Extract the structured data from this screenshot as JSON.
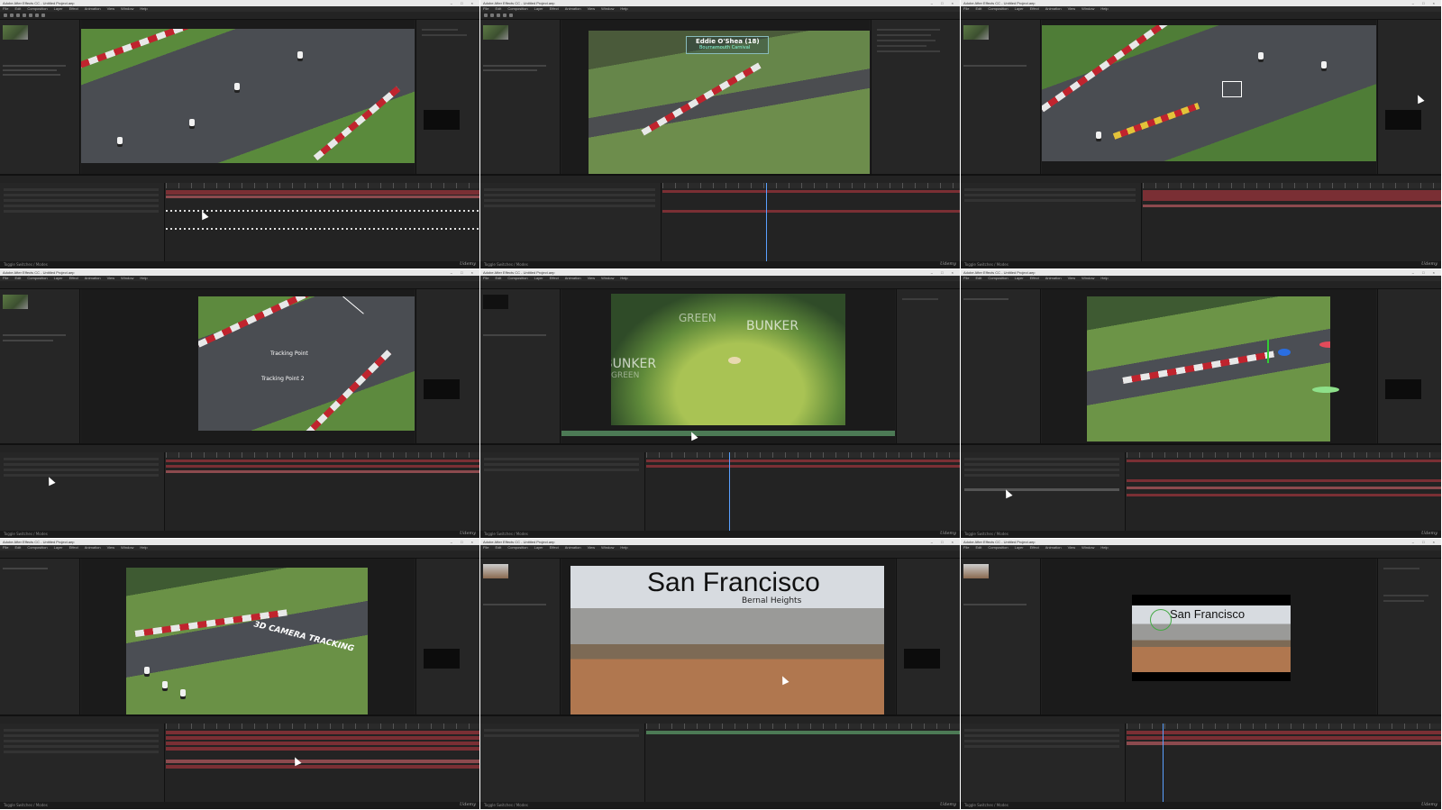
{
  "app": {
    "window_title": "Adobe After Effects CC - Untitled Project.aep",
    "window_controls": "– □ ×",
    "menu": [
      "File",
      "Edit",
      "Composition",
      "Layer",
      "Effect",
      "Animation",
      "View",
      "Window",
      "Help"
    ],
    "status": "Toggle Switches / Modes",
    "watermark": "Udemy"
  },
  "tiles": [
    {
      "id": "1",
      "overlay_texts": []
    },
    {
      "id": "2",
      "overlay_texts": [
        "Eddie O'Shea (18)",
        "Bournemouth Carnival"
      ]
    },
    {
      "id": "3",
      "overlay_texts": []
    },
    {
      "id": "4",
      "overlay_texts": [
        "Tracking Point",
        "Tracking Point 2"
      ]
    },
    {
      "id": "5",
      "overlay_texts": [
        "GREEN",
        "BUNKER",
        "BUNKER",
        "GREEN"
      ]
    },
    {
      "id": "6",
      "overlay_texts": []
    },
    {
      "id": "7",
      "overlay_texts": [
        "3D CAMERA TRACKING"
      ]
    },
    {
      "id": "8",
      "overlay_texts": [
        "San Francisco",
        "Bernal Heights"
      ]
    },
    {
      "id": "9",
      "overlay_texts": [
        "San Francisco"
      ]
    }
  ]
}
